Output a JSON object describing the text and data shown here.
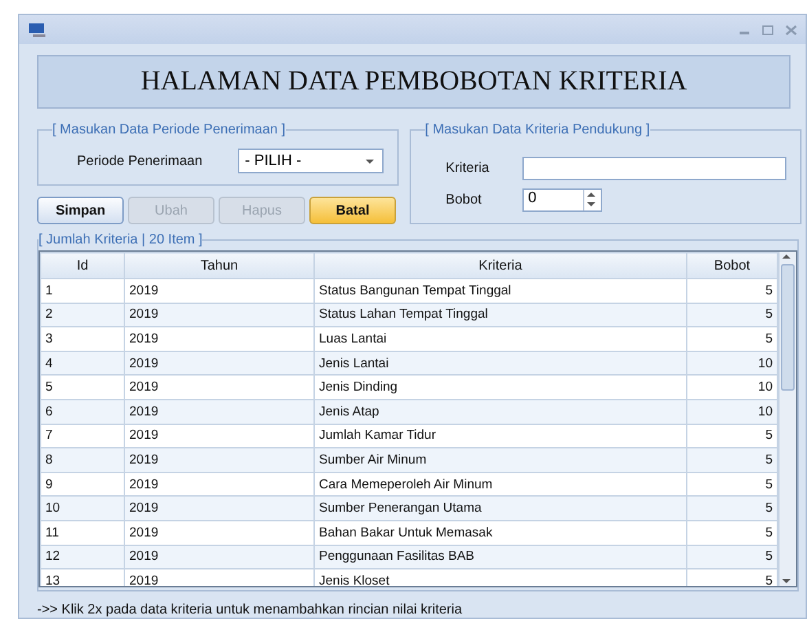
{
  "header": {
    "title": "HALAMAN DATA PEMBOBOTAN KRITERIA"
  },
  "periode_group": {
    "legend": "[ Masukan Data Periode Penerimaan ]",
    "label": "Periode Penerimaan",
    "value": "- PILIH -"
  },
  "buttons": [
    {
      "label": "Simpan",
      "disabled": false,
      "highlighted": false
    },
    {
      "label": "Ubah",
      "disabled": true,
      "highlighted": false
    },
    {
      "label": "Hapus",
      "disabled": true,
      "highlighted": false
    },
    {
      "label": "Batal",
      "disabled": false,
      "highlighted": true
    }
  ],
  "kriteria_group": {
    "legend": "[ Masukan Data Kriteria Pendukung ]",
    "kriteria_label": "Kriteria",
    "bobot_label": "Bobot",
    "bobot_value": "0"
  },
  "table": {
    "legend": "[ Jumlah Kriteria | 20 Item ]",
    "columns": [
      "Id",
      "Tahun",
      "Kriteria",
      "Bobot"
    ],
    "rows": [
      [
        "1",
        "2019",
        "Status Bangunan Tempat Tinggal",
        "5"
      ],
      [
        "2",
        "2019",
        "Status Lahan Tempat Tinggal",
        "5"
      ],
      [
        "3",
        "2019",
        "Luas Lantai",
        "5"
      ],
      [
        "4",
        "2019",
        "Jenis Lantai",
        "10"
      ],
      [
        "5",
        "2019",
        "Jenis Dinding",
        "10"
      ],
      [
        "6",
        "2019",
        "Jenis Atap",
        "10"
      ],
      [
        "7",
        "2019",
        "Jumlah Kamar Tidur",
        "5"
      ],
      [
        "8",
        "2019",
        "Sumber Air Minum",
        "5"
      ],
      [
        "9",
        "2019",
        "Cara Memeperoleh Air Minum",
        "5"
      ],
      [
        "10",
        "2019",
        "Sumber Penerangan Utama",
        "5"
      ],
      [
        "11",
        "2019",
        "Bahan Bakar Untuk Memasak",
        "5"
      ],
      [
        "12",
        "2019",
        "Penggunaan Fasilitas BAB",
        "5"
      ],
      [
        "13",
        "2019",
        "Jenis Kloset",
        "5"
      ]
    ]
  },
  "hint": "->> Klik 2x pada data kriteria untuk menambahkan rincian nilai kriteria"
}
